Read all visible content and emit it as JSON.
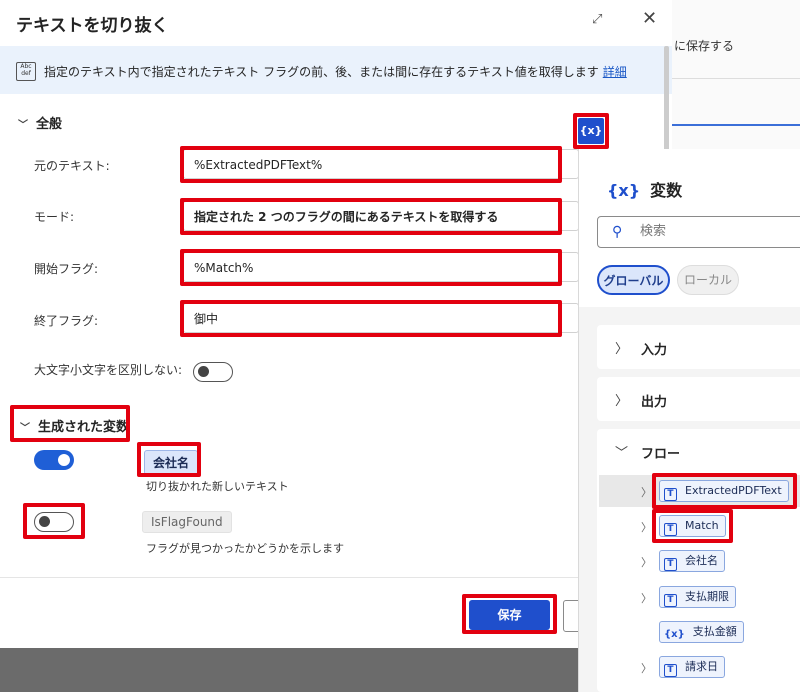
{
  "background": {
    "text": "に保存する"
  },
  "dialog": {
    "title": "テキストを切り抜く",
    "expand_glyph": "⤢",
    "close_glyph": "✕",
    "info": {
      "icon_text": "Abc def",
      "description": "指定のテキスト内で指定されたテキスト フラグの前、後、または間に存在するテキスト値を取得します",
      "link": "詳細"
    },
    "general": {
      "header": "全般",
      "fields": [
        {
          "label": "元のテキスト:",
          "value": "%ExtractedPDFText%"
        },
        {
          "label": "モード:",
          "value": "指定された 2 つのフラグの間にあるテキストを取得する"
        },
        {
          "label": "開始フラグ:",
          "value": "%Match%"
        },
        {
          "label": "終了フラグ:",
          "value": "御中"
        }
      ],
      "case_label": "大文字小文字を区別しない:"
    },
    "variables": {
      "header": "生成された変数",
      "items": [
        {
          "name": "会社名",
          "description": "切り抜かれた新しいテキスト",
          "enabled": true
        },
        {
          "name": "IsFlagFound",
          "description": "フラグが見つかったかどうかを示します",
          "enabled": false
        }
      ]
    },
    "var_button": "{x}",
    "save_label": "保存"
  },
  "var_panel": {
    "title": "変数",
    "search_placeholder": "検索",
    "tabs": [
      {
        "label": "グローバル",
        "selected": true
      },
      {
        "label": "ローカル",
        "selected": false
      }
    ],
    "sections": [
      "入力",
      "出力",
      "フロー"
    ],
    "flow_items": [
      {
        "name": "ExtractedPDFText",
        "icon": "T",
        "expandable": true
      },
      {
        "name": "Match",
        "icon": "T",
        "expandable": true
      },
      {
        "name": "会社名",
        "icon": "T",
        "expandable": true
      },
      {
        "name": "支払期限",
        "icon": "T",
        "expandable": true
      },
      {
        "name": "支払金額",
        "icon": "{x}",
        "expandable": false
      },
      {
        "name": "請求日",
        "icon": "T",
        "expandable": true
      }
    ]
  },
  "colors": {
    "accent": "#1f4fcc",
    "highlight": "#e2000f",
    "info_bg": "#eaf2fc"
  }
}
